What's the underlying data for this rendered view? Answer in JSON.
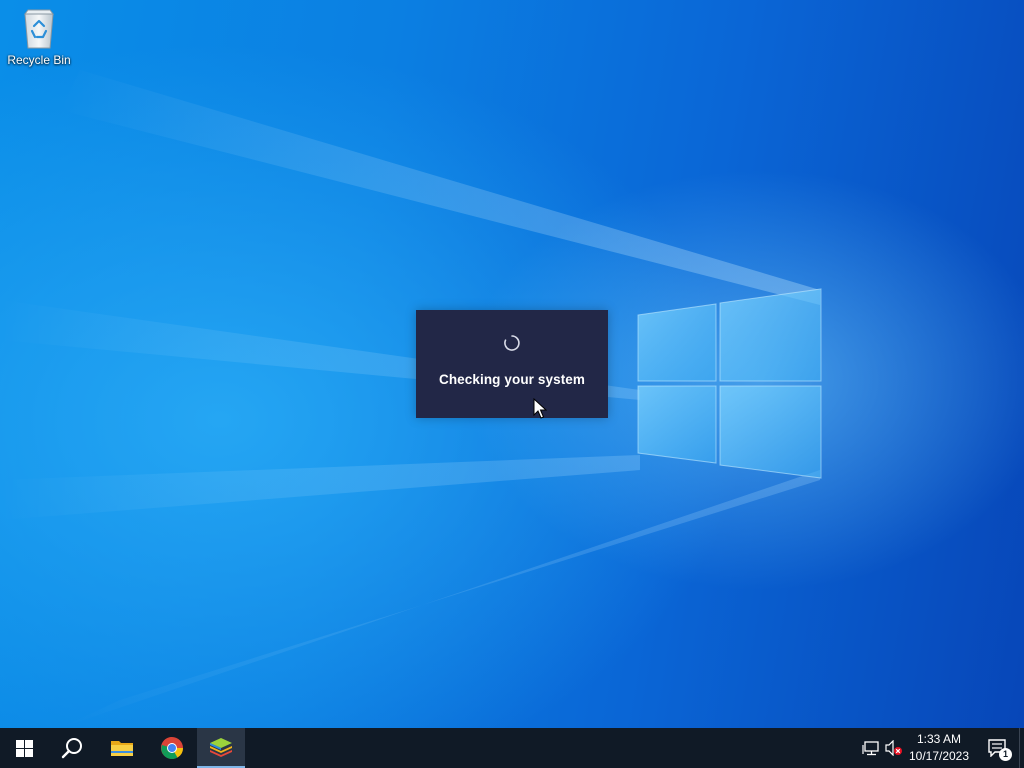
{
  "desktop": {
    "icons": [
      {
        "label": "Recycle Bin",
        "icon": "recycle-bin-icon"
      }
    ]
  },
  "dialog": {
    "message": "Checking your system",
    "icon": "loading-spinner-icon"
  },
  "taskbar": {
    "pinned": [
      {
        "name": "start",
        "icon": "windows-logo-icon"
      },
      {
        "name": "search",
        "icon": "search-icon"
      },
      {
        "name": "file-explorer",
        "icon": "folder-icon"
      },
      {
        "name": "chrome",
        "icon": "chrome-icon"
      },
      {
        "name": "bluestacks",
        "icon": "bluestacks-icon",
        "active": true
      }
    ],
    "tray": {
      "network_icon": "network-icon",
      "volume_icon": "volume-muted-icon",
      "time": "1:33 AM",
      "date": "10/17/2023",
      "notification_count": "1"
    }
  },
  "colors": {
    "taskbar": "#101a26",
    "dialog": "#222747",
    "wallpaper_accent": "#0a8ee8"
  }
}
